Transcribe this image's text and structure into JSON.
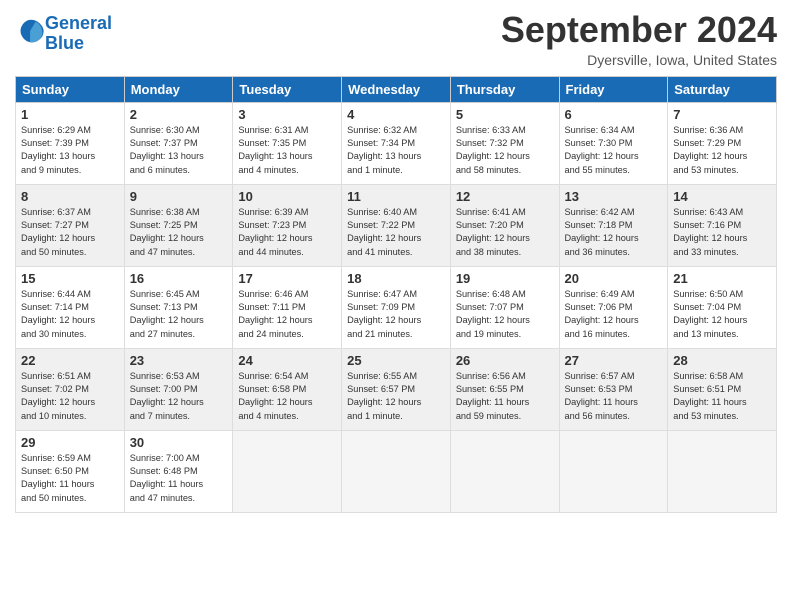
{
  "header": {
    "logo_line1": "General",
    "logo_line2": "Blue",
    "month_year": "September 2024",
    "location": "Dyersville, Iowa, United States"
  },
  "columns": [
    "Sunday",
    "Monday",
    "Tuesday",
    "Wednesday",
    "Thursday",
    "Friday",
    "Saturday"
  ],
  "weeks": [
    [
      {
        "day": "1",
        "lines": [
          "Sunrise: 6:29 AM",
          "Sunset: 7:39 PM",
          "Daylight: 13 hours",
          "and 9 minutes."
        ]
      },
      {
        "day": "2",
        "lines": [
          "Sunrise: 6:30 AM",
          "Sunset: 7:37 PM",
          "Daylight: 13 hours",
          "and 6 minutes."
        ]
      },
      {
        "day": "3",
        "lines": [
          "Sunrise: 6:31 AM",
          "Sunset: 7:35 PM",
          "Daylight: 13 hours",
          "and 4 minutes."
        ]
      },
      {
        "day": "4",
        "lines": [
          "Sunrise: 6:32 AM",
          "Sunset: 7:34 PM",
          "Daylight: 13 hours",
          "and 1 minute."
        ]
      },
      {
        "day": "5",
        "lines": [
          "Sunrise: 6:33 AM",
          "Sunset: 7:32 PM",
          "Daylight: 12 hours",
          "and 58 minutes."
        ]
      },
      {
        "day": "6",
        "lines": [
          "Sunrise: 6:34 AM",
          "Sunset: 7:30 PM",
          "Daylight: 12 hours",
          "and 55 minutes."
        ]
      },
      {
        "day": "7",
        "lines": [
          "Sunrise: 6:36 AM",
          "Sunset: 7:29 PM",
          "Daylight: 12 hours",
          "and 53 minutes."
        ]
      }
    ],
    [
      {
        "day": "8",
        "lines": [
          "Sunrise: 6:37 AM",
          "Sunset: 7:27 PM",
          "Daylight: 12 hours",
          "and 50 minutes."
        ]
      },
      {
        "day": "9",
        "lines": [
          "Sunrise: 6:38 AM",
          "Sunset: 7:25 PM",
          "Daylight: 12 hours",
          "and 47 minutes."
        ]
      },
      {
        "day": "10",
        "lines": [
          "Sunrise: 6:39 AM",
          "Sunset: 7:23 PM",
          "Daylight: 12 hours",
          "and 44 minutes."
        ]
      },
      {
        "day": "11",
        "lines": [
          "Sunrise: 6:40 AM",
          "Sunset: 7:22 PM",
          "Daylight: 12 hours",
          "and 41 minutes."
        ]
      },
      {
        "day": "12",
        "lines": [
          "Sunrise: 6:41 AM",
          "Sunset: 7:20 PM",
          "Daylight: 12 hours",
          "and 38 minutes."
        ]
      },
      {
        "day": "13",
        "lines": [
          "Sunrise: 6:42 AM",
          "Sunset: 7:18 PM",
          "Daylight: 12 hours",
          "and 36 minutes."
        ]
      },
      {
        "day": "14",
        "lines": [
          "Sunrise: 6:43 AM",
          "Sunset: 7:16 PM",
          "Daylight: 12 hours",
          "and 33 minutes."
        ]
      }
    ],
    [
      {
        "day": "15",
        "lines": [
          "Sunrise: 6:44 AM",
          "Sunset: 7:14 PM",
          "Daylight: 12 hours",
          "and 30 minutes."
        ]
      },
      {
        "day": "16",
        "lines": [
          "Sunrise: 6:45 AM",
          "Sunset: 7:13 PM",
          "Daylight: 12 hours",
          "and 27 minutes."
        ]
      },
      {
        "day": "17",
        "lines": [
          "Sunrise: 6:46 AM",
          "Sunset: 7:11 PM",
          "Daylight: 12 hours",
          "and 24 minutes."
        ]
      },
      {
        "day": "18",
        "lines": [
          "Sunrise: 6:47 AM",
          "Sunset: 7:09 PM",
          "Daylight: 12 hours",
          "and 21 minutes."
        ]
      },
      {
        "day": "19",
        "lines": [
          "Sunrise: 6:48 AM",
          "Sunset: 7:07 PM",
          "Daylight: 12 hours",
          "and 19 minutes."
        ]
      },
      {
        "day": "20",
        "lines": [
          "Sunrise: 6:49 AM",
          "Sunset: 7:06 PM",
          "Daylight: 12 hours",
          "and 16 minutes."
        ]
      },
      {
        "day": "21",
        "lines": [
          "Sunrise: 6:50 AM",
          "Sunset: 7:04 PM",
          "Daylight: 12 hours",
          "and 13 minutes."
        ]
      }
    ],
    [
      {
        "day": "22",
        "lines": [
          "Sunrise: 6:51 AM",
          "Sunset: 7:02 PM",
          "Daylight: 12 hours",
          "and 10 minutes."
        ]
      },
      {
        "day": "23",
        "lines": [
          "Sunrise: 6:53 AM",
          "Sunset: 7:00 PM",
          "Daylight: 12 hours",
          "and 7 minutes."
        ]
      },
      {
        "day": "24",
        "lines": [
          "Sunrise: 6:54 AM",
          "Sunset: 6:58 PM",
          "Daylight: 12 hours",
          "and 4 minutes."
        ]
      },
      {
        "day": "25",
        "lines": [
          "Sunrise: 6:55 AM",
          "Sunset: 6:57 PM",
          "Daylight: 12 hours",
          "and 1 minute."
        ]
      },
      {
        "day": "26",
        "lines": [
          "Sunrise: 6:56 AM",
          "Sunset: 6:55 PM",
          "Daylight: 11 hours",
          "and 59 minutes."
        ]
      },
      {
        "day": "27",
        "lines": [
          "Sunrise: 6:57 AM",
          "Sunset: 6:53 PM",
          "Daylight: 11 hours",
          "and 56 minutes."
        ]
      },
      {
        "day": "28",
        "lines": [
          "Sunrise: 6:58 AM",
          "Sunset: 6:51 PM",
          "Daylight: 11 hours",
          "and 53 minutes."
        ]
      }
    ],
    [
      {
        "day": "29",
        "lines": [
          "Sunrise: 6:59 AM",
          "Sunset: 6:50 PM",
          "Daylight: 11 hours",
          "and 50 minutes."
        ]
      },
      {
        "day": "30",
        "lines": [
          "Sunrise: 7:00 AM",
          "Sunset: 6:48 PM",
          "Daylight: 11 hours",
          "and 47 minutes."
        ]
      },
      null,
      null,
      null,
      null,
      null
    ]
  ]
}
